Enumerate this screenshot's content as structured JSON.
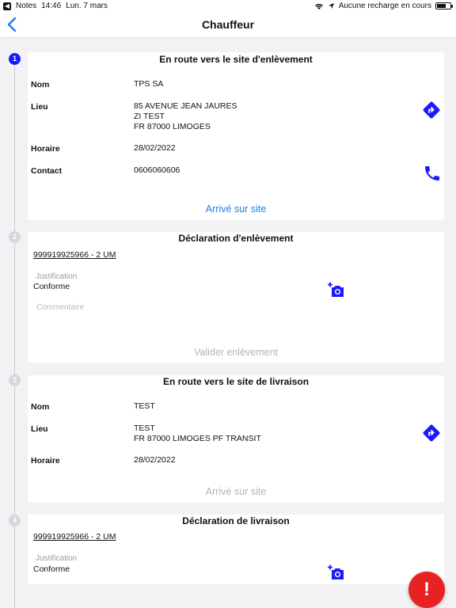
{
  "status_bar": {
    "app_back": "Notes",
    "time": "14:46",
    "date": "Lun. 7 mars",
    "charging": "Aucune recharge en cours",
    "battery_level": 0.6
  },
  "nav": {
    "title": "Chauffeur"
  },
  "steps": [
    {
      "number": "1",
      "title": "En route vers le site d'enlèvement",
      "rows": {
        "nom_label": "Nom",
        "nom_value": "TPS SA",
        "lieu_label": "Lieu",
        "lieu_line1": "85 AVENUE JEAN JAURES",
        "lieu_line2": "ZI TEST",
        "lieu_line3": "FR 87000 LIMOGES",
        "horaire_label": "Horaire",
        "horaire_value": "28/02/2022",
        "contact_label": "Contact",
        "contact_value": "0606060606"
      },
      "action": "Arrivé sur site"
    },
    {
      "number": "2",
      "title": "Déclaration d'enlèvement",
      "reference": "999919925966 - 2 UM",
      "justification_label": "Justification",
      "justification_value": "Conforme",
      "comment_placeholder": "Commentaire",
      "action": "Valider enlèvement"
    },
    {
      "number": "3",
      "title": "En route vers le site de livraison",
      "rows": {
        "nom_label": "Nom",
        "nom_value": "TEST",
        "lieu_label": "Lieu",
        "lieu_line1": "TEST",
        "lieu_line2": "FR 87000 LIMOGES PF TRANSIT",
        "horaire_label": "Horaire",
        "horaire_value": "28/02/2022"
      },
      "action": "Arrivé sur site"
    },
    {
      "number": "4",
      "title": "Déclaration de livraison",
      "reference": "999919925966 - 2 UM",
      "justification_label": "Justification",
      "justification_value": "Conforme"
    }
  ],
  "fab": {
    "label": "!"
  },
  "colors": {
    "accent": "#1a1aff",
    "link": "#1c7ef0",
    "alert": "#e82222"
  }
}
